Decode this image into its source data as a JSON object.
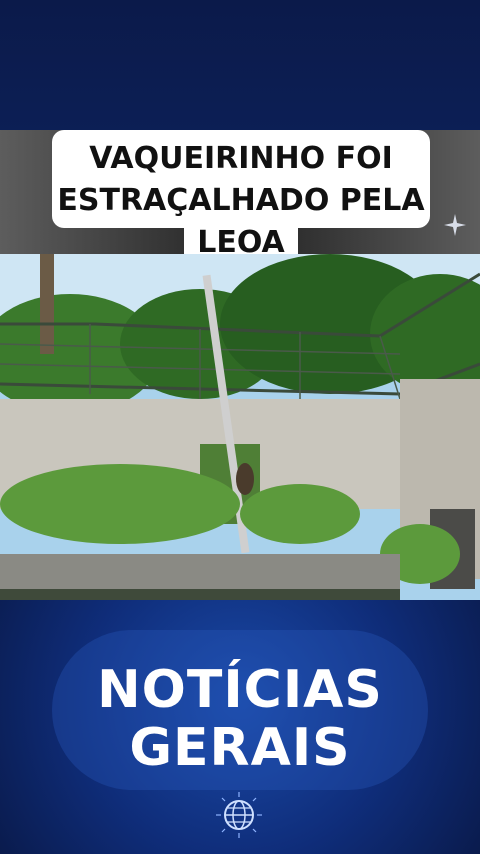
{
  "headline": {
    "line1": "VAQUEIRINHO FOI",
    "line2": "ESTRAÇALHADO PELA",
    "line3": "LEOA"
  },
  "brand": {
    "line1": "NOTÍCIAS",
    "line2": "GERAIS"
  },
  "icons": {
    "sparkle": "sparkle-icon",
    "globe": "globe-icon"
  },
  "colors": {
    "background": "#0f2a6e",
    "headline_box": "#ffffff",
    "brand_text": "#ffffff"
  }
}
